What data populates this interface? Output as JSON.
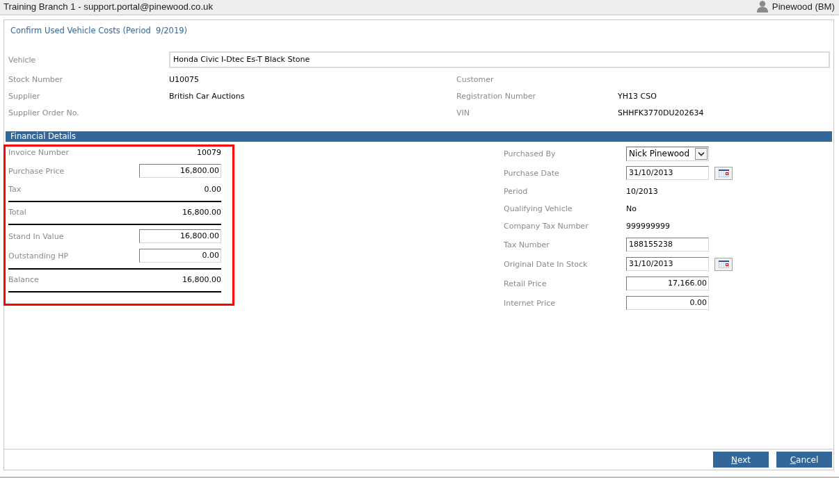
{
  "header": {
    "title": "Training Branch 1 - support.portal@pinewood.co.uk",
    "user": "Pinewood (BM)"
  },
  "form": {
    "title": "Confirm Used Vehicle Costs (Period  9/2019)",
    "vehicle": {
      "label": "Vehicle",
      "value": "Honda Civic I-Dtec Es-T Black Stone"
    },
    "details_left": [
      {
        "label": "Stock Number",
        "value": "U10075"
      },
      {
        "label": "Supplier",
        "value": "British Car Auctions"
      },
      {
        "label": "Supplier Order No."
      }
    ],
    "details_right": [
      {
        "label": "Customer"
      },
      {
        "label": "Registration Number",
        "value": "YH13 CSO"
      },
      {
        "label": "VIN",
        "value": "SHHFK3770DU202634"
      }
    ]
  },
  "financial": {
    "title": "Financial Details",
    "highlighted": true,
    "costs": [
      {
        "kind": "text",
        "label": "Invoice Number",
        "value": "10079",
        "rule_below": false
      },
      {
        "kind": "amount",
        "label": "Purchase Price",
        "value": "16,800.00",
        "rule_below": false
      },
      {
        "kind": "text",
        "label": "Tax",
        "value": "0.00",
        "rule_below": true
      },
      {
        "kind": "text",
        "label": "Total",
        "value": "16,800.00",
        "rule_below": true
      },
      {
        "kind": "amount",
        "label": "Stand In Value",
        "value": "16,800.00",
        "rule_below": false
      },
      {
        "kind": "amount",
        "label": "Outstanding HP",
        "value": "0.00",
        "rule_below": true
      },
      {
        "kind": "text",
        "label": "Balance",
        "value": "16,800.00",
        "rule_below": true
      }
    ],
    "purchase": [
      {
        "kind": "select",
        "label": "Purchased By",
        "value": "Nick Pinewood"
      },
      {
        "kind": "date",
        "label": "Purchase Date",
        "value": "31/10/2013"
      },
      {
        "kind": "text",
        "label": "Period",
        "value": "10/2013"
      },
      {
        "kind": "text",
        "label": "Qualifying Vehicle",
        "value": "No"
      },
      {
        "kind": "text",
        "label": "Company Tax Number",
        "value": "999999999"
      },
      {
        "kind": "field",
        "label": "Tax Number",
        "value": "188155238"
      },
      {
        "kind": "date",
        "label": "Original Date In Stock",
        "value": "31/10/2013"
      },
      {
        "kind": "amount",
        "label": "Retail Price",
        "value": "17,166.00"
      },
      {
        "kind": "amount",
        "label": "Internet Price",
        "value": "0.00"
      }
    ]
  },
  "buttons": [
    {
      "label": "Next",
      "mnemonic_underlined": true
    },
    {
      "label": "Cancel",
      "mnemonic_underlined": true
    }
  ]
}
